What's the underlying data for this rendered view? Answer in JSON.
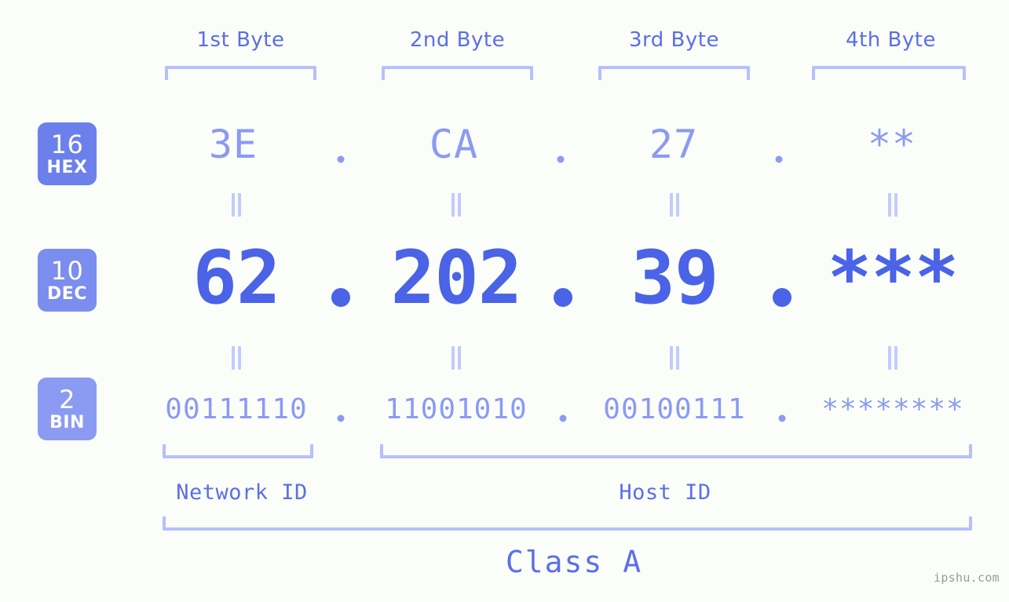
{
  "page": {
    "background_color": "#fbfdf9",
    "watermark": "ipshu.com"
  },
  "colors": {
    "accent_strong": "#4a63e7",
    "accent_mid": "#5a6fe8",
    "accent_light": "#8b9bf1",
    "bracket": "#b6c0fb",
    "equals": "#c3cbfc",
    "badge_hex": "#6c80ec",
    "badge_dec": "#7b8dee",
    "badge_bin": "#8b9bf1",
    "watermark": "#9a9a9a"
  },
  "byte_headers": [
    {
      "label": "1st Byte"
    },
    {
      "label": "2nd Byte"
    },
    {
      "label": "3rd Byte"
    },
    {
      "label": "4th Byte"
    }
  ],
  "bases": [
    {
      "number": "16",
      "name": "HEX"
    },
    {
      "number": "10",
      "name": "DEC"
    },
    {
      "number": "2",
      "name": "BIN"
    }
  ],
  "rows": {
    "hex": {
      "base_number": "16",
      "base_name": "HEX",
      "values": [
        "3E",
        "CA",
        "27",
        "**"
      ],
      "separator": "."
    },
    "dec": {
      "base_number": "10",
      "base_name": "DEC",
      "values": [
        "62",
        "202",
        "39",
        "***"
      ],
      "separator": "."
    },
    "bin": {
      "base_number": "2",
      "base_name": "BIN",
      "values": [
        "00111110",
        "11001010",
        "00100111",
        "********"
      ],
      "separator": "."
    }
  },
  "connectors": {
    "symbol": "=",
    "count_per_gap": 4,
    "gaps": 2
  },
  "segments": {
    "network_id": {
      "label": "Network ID"
    },
    "host_id": {
      "label": "Host ID"
    },
    "class": {
      "label": "Class A"
    }
  }
}
